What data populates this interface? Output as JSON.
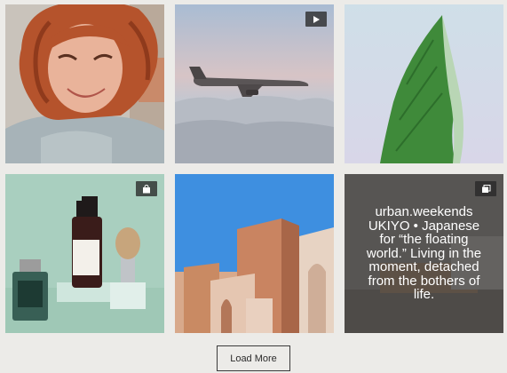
{
  "gallery": {
    "items": [
      {
        "subject": "woman laughing with curly red hair",
        "badge": null
      },
      {
        "subject": "airplane flying above clouds",
        "badge": "video-icon"
      },
      {
        "subject": "green leaf against pale blue sky",
        "badge": null
      },
      {
        "subject": "grooming products on mint background",
        "badge": "shopping-bag-icon"
      },
      {
        "subject": "terracotta building against blue sky",
        "badge": null
      },
      {
        "subject": "dim interior with text overlay",
        "badge": "gallery-icon",
        "caption_lines": [
          "urban.weekends",
          "UKIYO • Japanese",
          "for “the floating",
          "world.” Living in the",
          "moment, detached",
          "from the bothers of",
          "life."
        ]
      }
    ]
  },
  "load_more": {
    "label": "Load More"
  },
  "colors": {
    "page_bg": "#ecebe8",
    "badge_bg": "#333333",
    "button_border": "#3b3b3b"
  }
}
